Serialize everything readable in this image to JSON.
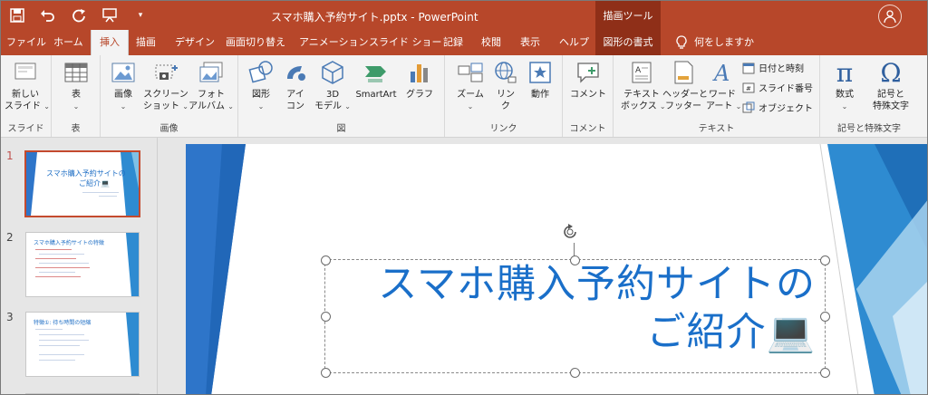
{
  "title_bar": {
    "document_title": "スマホ購入予約サイト.pptx  -  PowerPoint",
    "context_tab_title": "描画ツール"
  },
  "tabs": {
    "file": "ファイル",
    "home": "ホーム",
    "insert": "挿入",
    "draw": "描画",
    "design": "デザイン",
    "transitions": "画面切り替え",
    "animations": "アニメーション",
    "slideshow": "スライド ショー",
    "record": "記録",
    "review": "校閲",
    "view": "表示",
    "help": "ヘルプ",
    "format": "図形の書式",
    "tell_me": "何をしますか"
  },
  "ribbon": {
    "slides": {
      "new_slide_1": "新しい",
      "new_slide_2": "スライド",
      "group": "スライド"
    },
    "table": {
      "table": "表",
      "group": "表"
    },
    "images": {
      "picture": "画像",
      "screenshot_1": "スクリーン",
      "screenshot_2": "ショット",
      "album_1": "フォト",
      "album_2": "アルバム",
      "group": "画像"
    },
    "illustrations": {
      "shapes": "図形",
      "icons_1": "アイ",
      "icons_2": "コン",
      "models_1": "3D",
      "models_2": "モデル",
      "smartart": "SmartArt",
      "chart": "グラフ",
      "group": "図"
    },
    "links": {
      "zoom": "ズーム",
      "link_1": "リン",
      "link_2": "ク",
      "action": "動作",
      "group": "リンク"
    },
    "comments": {
      "comment": "コメント",
      "group": "コメント"
    },
    "text": {
      "textbox_1": "テキスト",
      "textbox_2": "ボックス",
      "header_1": "ヘッダーと",
      "header_2": "フッター",
      "wordart_1": "ワード",
      "wordart_2": "アート",
      "datetime": "日付と時刻",
      "slide_number": "スライド番号",
      "object": "オブジェクト",
      "group": "テキスト"
    },
    "symbols": {
      "equation": "数式",
      "symbol_1": "記号と",
      "symbol_2": "特殊文字",
      "group": "記号と特殊文字"
    }
  },
  "thumbnails": [
    {
      "number": "1",
      "title_1": "スマホ購入予約サイトの",
      "title_2": "ご紹介💻"
    },
    {
      "number": "2",
      "title_1": "スマホ購入予約サイトの特徴",
      "title_2": ""
    },
    {
      "number": "3",
      "title_1": "特徴①: 待ち時間の短縮",
      "title_2": ""
    }
  ],
  "slide": {
    "title_line1": "スマホ購入予約サイトの",
    "title_line2": "ご紹介💻"
  },
  "colors": {
    "accent": "#b7472a",
    "context": "#8f2f18",
    "title_blue": "#1a6fc9"
  }
}
